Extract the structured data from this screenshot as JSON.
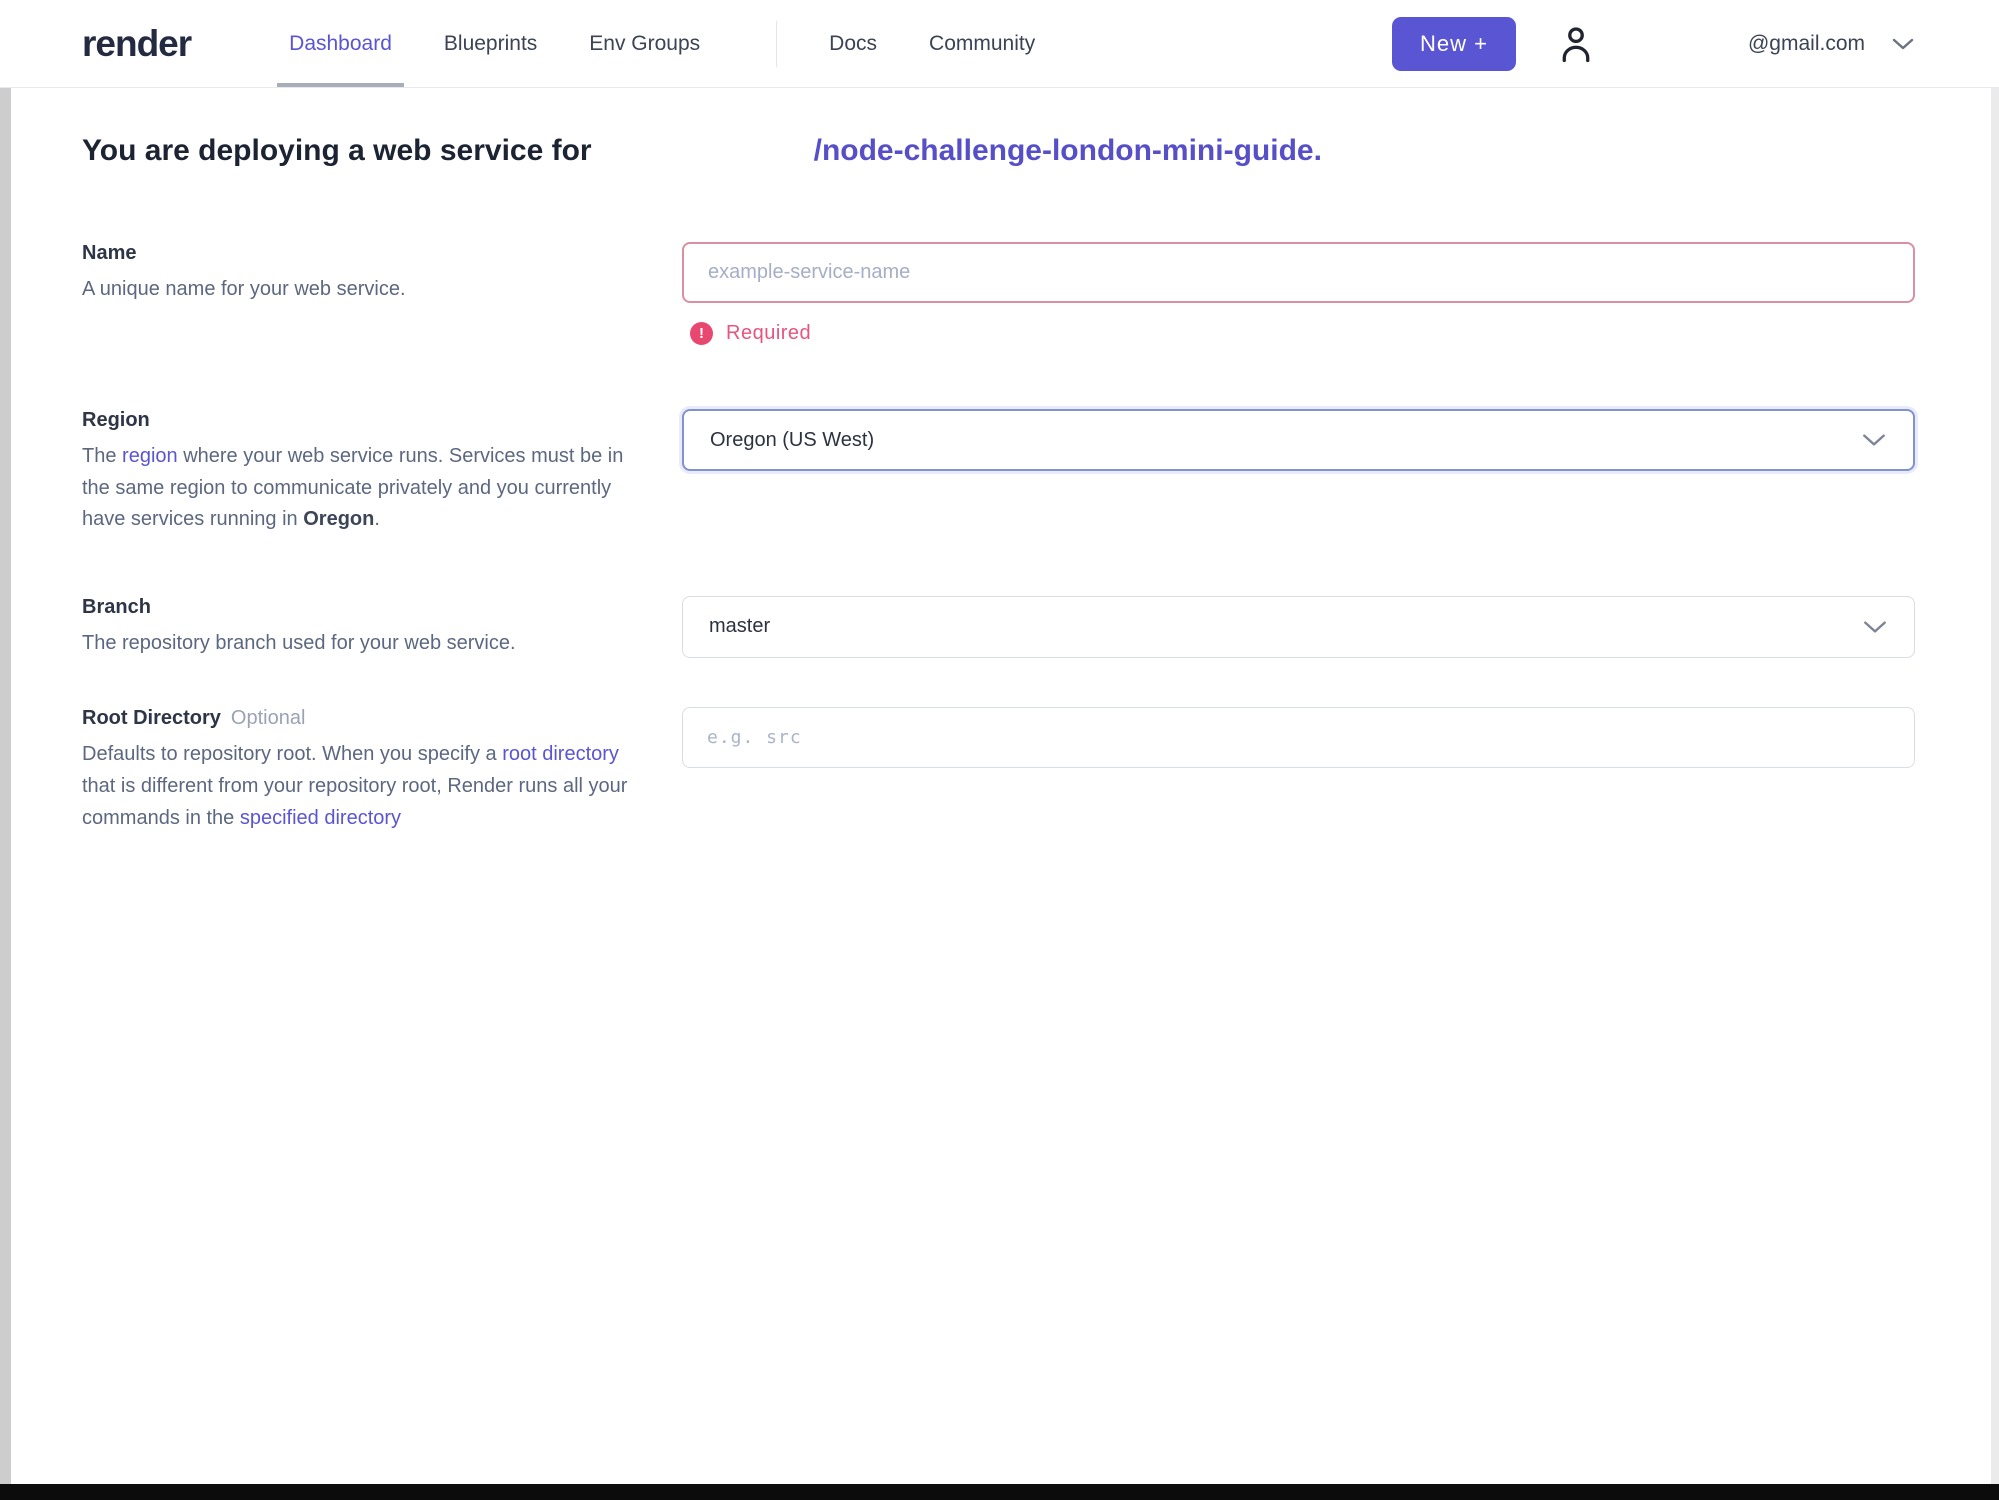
{
  "colors": {
    "accent": "#5a55d2",
    "repo_link": "#564fc8",
    "error": "#e8547e",
    "error_border": "#d98fa4",
    "focus_border": "#8092d0"
  },
  "header": {
    "logo": "render",
    "nav": [
      {
        "label": "Dashboard",
        "active": true
      },
      {
        "label": "Blueprints",
        "active": false
      },
      {
        "label": "Env Groups",
        "active": false
      },
      {
        "label": "Docs",
        "active": false
      },
      {
        "label": "Community",
        "active": false
      }
    ],
    "new_button_label": "New +",
    "account_email": "@gmail.com",
    "icons": {
      "account": "person-icon",
      "account_dropdown": "chevron-down-icon"
    }
  },
  "heading": {
    "prefix": "You are deploying a web service for",
    "repo": "/node-challenge-london-mini-guide",
    "suffix": "."
  },
  "form": {
    "name": {
      "label": "Name",
      "description": "A unique name for your web service.",
      "placeholder": "example-service-name",
      "error_icon": "!",
      "error": "Required"
    },
    "region": {
      "label": "Region",
      "desc_pre": "The ",
      "desc_link": "region",
      "desc_mid": " where your web service runs. Services must be in the same region to communicate privately and you currently have services running in ",
      "desc_bold": "Oregon",
      "desc_end": ".",
      "value": "Oregon (US West)"
    },
    "branch": {
      "label": "Branch",
      "description": "The repository branch used for your web service.",
      "value": "master"
    },
    "root_directory": {
      "label": "Root Directory",
      "optional": "Optional",
      "desc_pre": "Defaults to repository root. When you specify a ",
      "desc_link1": "root directory",
      "desc_mid": " that is different from your repository root, Render runs all your commands in the ",
      "desc_link2": "specified directory",
      "placeholder": "e.g. src"
    }
  }
}
